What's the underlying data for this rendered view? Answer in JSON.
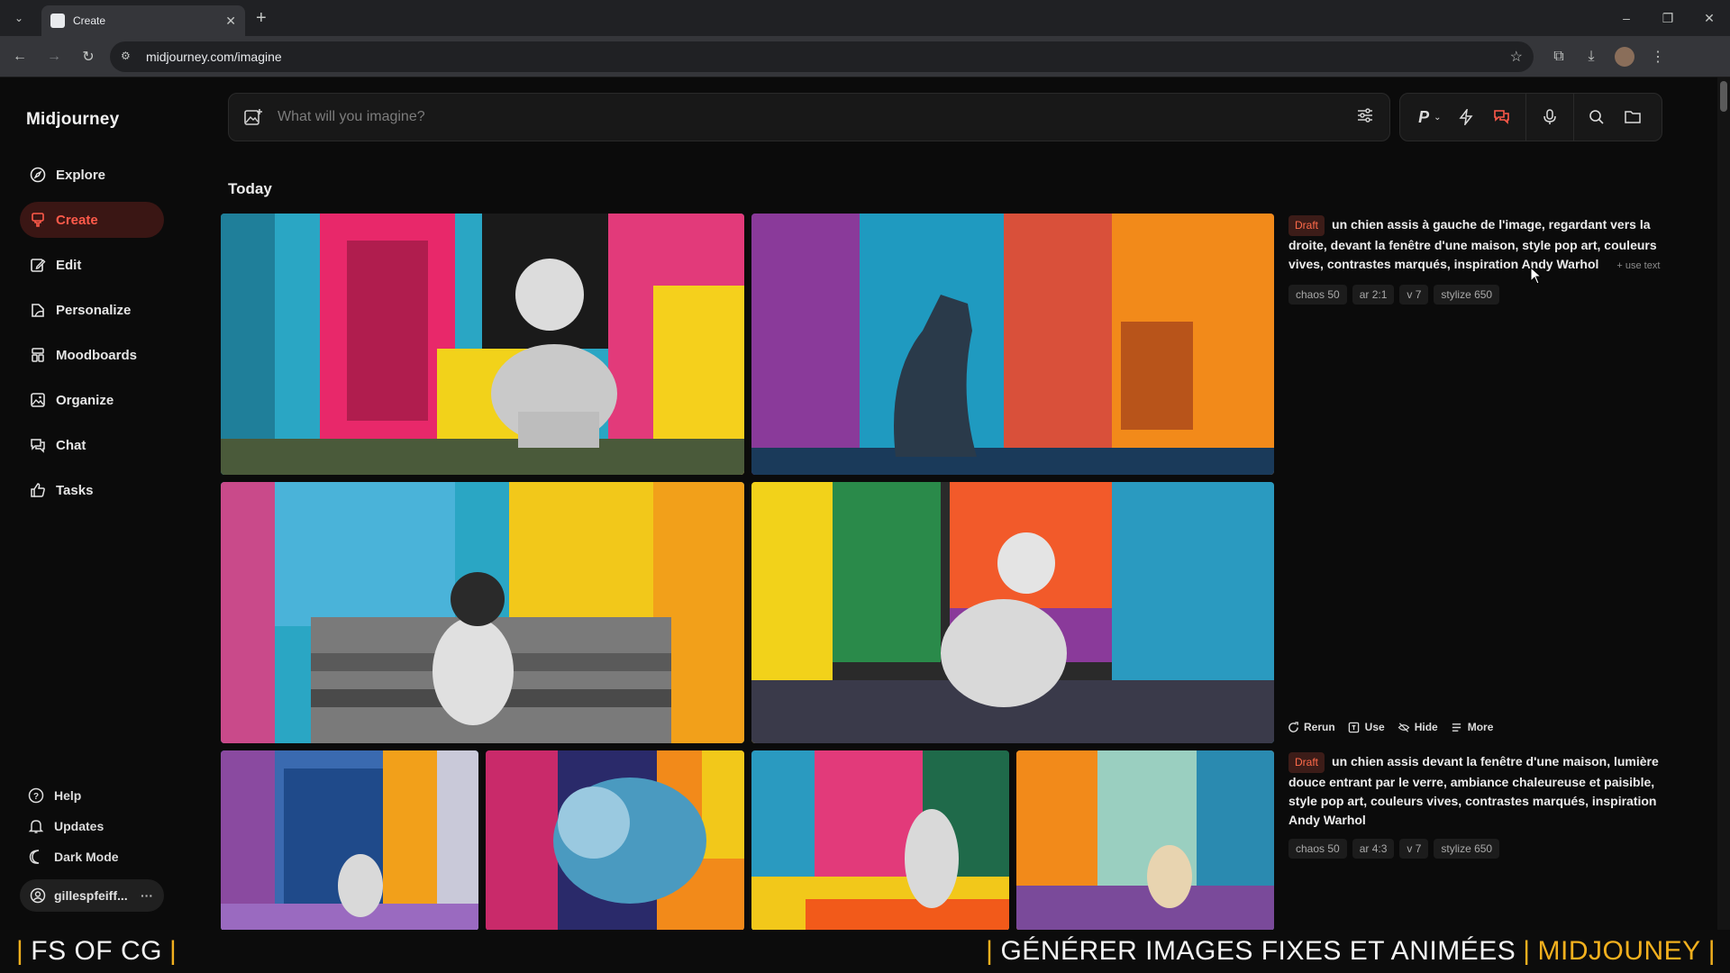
{
  "browser": {
    "tab_title": "Create",
    "url": "midjourney.com/imagine"
  },
  "sidebar": {
    "logo": "Midjourney",
    "items": [
      {
        "label": "Explore",
        "icon": "compass-icon"
      },
      {
        "label": "Create",
        "icon": "brush-icon",
        "active": true
      },
      {
        "label": "Edit",
        "icon": "edit-icon"
      },
      {
        "label": "Personalize",
        "icon": "personalize-icon"
      },
      {
        "label": "Moodboards",
        "icon": "moodboard-icon"
      },
      {
        "label": "Organize",
        "icon": "image-icon"
      },
      {
        "label": "Chat",
        "icon": "chat-icon"
      },
      {
        "label": "Tasks",
        "icon": "thumbs-up-icon"
      }
    ],
    "bottom": [
      {
        "label": "Help",
        "icon": "help-icon"
      },
      {
        "label": "Updates",
        "icon": "bell-icon"
      },
      {
        "label": "Dark Mode",
        "icon": "moon-icon"
      }
    ],
    "user": "gillespfeiff..."
  },
  "prompt_bar": {
    "placeholder": "What will you imagine?",
    "personalize_label": "P"
  },
  "section_title": "Today",
  "cards": [
    {
      "badge": "Draft",
      "text": "un chien assis à gauche de l'image, regardant vers la droite, devant la fenêtre d'une maison, style pop art, couleurs vives, contrastes marqués, inspiration Andy Warhol",
      "use_text": "+ use text",
      "params": [
        "chaos 50",
        "ar 2:1",
        "v 7",
        "stylize 650"
      ]
    },
    {
      "badge": "Draft",
      "text": "un chien assis devant la fenêtre d'une maison, lumière douce entrant par le verre, ambiance chaleureuse et paisible, style pop art, couleurs vives, contrastes marqués, inspiration Andy Warhol",
      "params": [
        "chaos 50",
        "ar 4:3",
        "v 7",
        "stylize 650"
      ]
    }
  ],
  "actions": {
    "rerun": "Rerun",
    "use": "Use",
    "hide": "Hide",
    "more": "More"
  },
  "banner": {
    "left": "FS OF CG",
    "right_main": "GÉNÉRER IMAGES FIXES ET ANIMÉES",
    "right_accent": "MIDJOUNEY"
  },
  "colors": {
    "accent_red": "#ff5a4a",
    "banner_accent": "#f2b01e"
  }
}
